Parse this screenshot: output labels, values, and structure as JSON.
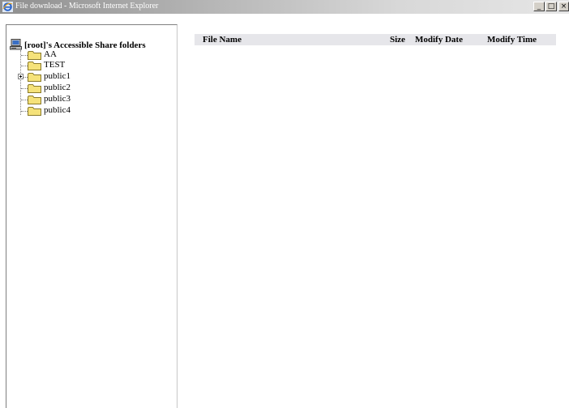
{
  "window": {
    "title": "File download - Microsoft Internet Explorer",
    "controls": {
      "minimize": "_",
      "maximize": "□",
      "close": "×"
    }
  },
  "tree": {
    "root_label": "[root]'s Accessible Share folders",
    "items": [
      {
        "label": "AA",
        "expandable": false
      },
      {
        "label": "TEST",
        "expandable": false
      },
      {
        "label": "public1",
        "expandable": true
      },
      {
        "label": "public2",
        "expandable": false
      },
      {
        "label": "public3",
        "expandable": false
      },
      {
        "label": "public4",
        "expandable": false
      }
    ]
  },
  "file_table": {
    "columns": [
      "File Name",
      "Size",
      "Modify Date",
      "Modify Time"
    ],
    "rows": []
  },
  "colors": {
    "header_bg": "#e6e6ea",
    "folder": "#f5e27a",
    "titlebar": "#a9a9a9"
  }
}
